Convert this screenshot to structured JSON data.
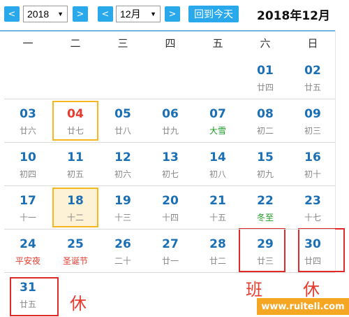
{
  "toolbar": {
    "prev_year": "<",
    "year_value": "2018",
    "next_year": ">",
    "prev_month": "<",
    "month_value": "12月",
    "next_month": ">",
    "today_label": "回到今天",
    "title": "2018年12月"
  },
  "weekdays": [
    "一",
    "二",
    "三",
    "四",
    "五",
    "六",
    "日"
  ],
  "weeks": [
    [
      null,
      null,
      null,
      null,
      null,
      {
        "day": "01",
        "lunar": "廿四"
      },
      {
        "day": "02",
        "lunar": "廿五"
      }
    ],
    [
      {
        "day": "03",
        "lunar": "廿六"
      },
      {
        "day": "04",
        "lunar": "廿七",
        "today": true
      },
      {
        "day": "05",
        "lunar": "廿八"
      },
      {
        "day": "06",
        "lunar": "廿九"
      },
      {
        "day": "07",
        "lunar": "大雪",
        "term": true
      },
      {
        "day": "08",
        "lunar": "初二"
      },
      {
        "day": "09",
        "lunar": "初三"
      }
    ],
    [
      {
        "day": "10",
        "lunar": "初四"
      },
      {
        "day": "11",
        "lunar": "初五"
      },
      {
        "day": "12",
        "lunar": "初六"
      },
      {
        "day": "13",
        "lunar": "初七"
      },
      {
        "day": "14",
        "lunar": "初八"
      },
      {
        "day": "15",
        "lunar": "初九"
      },
      {
        "day": "16",
        "lunar": "初十"
      }
    ],
    [
      {
        "day": "17",
        "lunar": "十一"
      },
      {
        "day": "18",
        "lunar": "十二",
        "selected": true
      },
      {
        "day": "19",
        "lunar": "十三"
      },
      {
        "day": "20",
        "lunar": "十四"
      },
      {
        "day": "21",
        "lunar": "十五"
      },
      {
        "day": "22",
        "lunar": "冬至",
        "term": true
      },
      {
        "day": "23",
        "lunar": "十七"
      }
    ],
    [
      {
        "day": "24",
        "lunar": "平安夜",
        "festival": true
      },
      {
        "day": "25",
        "lunar": "圣诞节",
        "festival": true
      },
      {
        "day": "26",
        "lunar": "二十"
      },
      {
        "day": "27",
        "lunar": "廿一"
      },
      {
        "day": "28",
        "lunar": "廿二"
      },
      {
        "day": "29",
        "lunar": "廿三"
      },
      {
        "day": "30",
        "lunar": "廿四"
      }
    ],
    [
      {
        "day": "31",
        "lunar": "廿五"
      },
      null,
      null,
      null,
      null,
      null,
      null
    ]
  ],
  "annotations": {
    "work_label": "班",
    "rest_label_1": "休",
    "rest_label_2": "休"
  },
  "watermark": "www.ruiteli.com",
  "colors": {
    "accent": "#29a9ec",
    "day_number": "#1b6fb5",
    "today_number": "#e63b2e",
    "solar_term": "#1c9a23",
    "festival": "#e63b2e",
    "highlight_border": "#f5b721",
    "annotation_red": "#e02a2a"
  }
}
